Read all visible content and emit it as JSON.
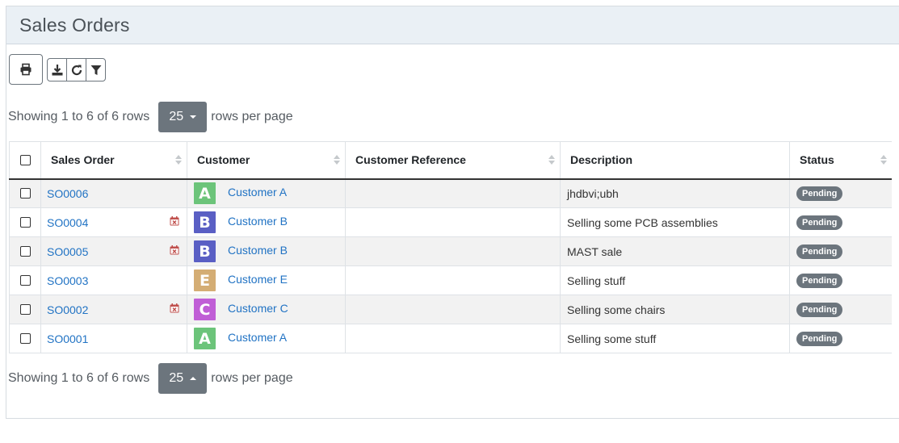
{
  "page": {
    "title": "Sales Orders"
  },
  "toolbar": {
    "print_icon": "print-icon",
    "download_icon": "download-icon",
    "refresh_icon": "refresh-icon",
    "filter_icon": "filter-icon"
  },
  "pagination": {
    "showing_text": "Showing 1 to 6 of 6 rows",
    "page_size": "25",
    "rows_per_page_text": "rows per page"
  },
  "table": {
    "columns": [
      "Sales Order",
      "Customer",
      "Customer Reference",
      "Description",
      "Status"
    ],
    "rows": [
      {
        "so": "SO0006",
        "overdue": false,
        "avatar": "A",
        "avatar_color": "#6cc47a",
        "customer": "Customer A",
        "reference": "",
        "description": "jhdbvi;ubh",
        "status": "Pending"
      },
      {
        "so": "SO0004",
        "overdue": true,
        "avatar": "B",
        "avatar_color": "#5a5fc4",
        "customer": "Customer B",
        "reference": "",
        "description": "Selling some PCB assemblies",
        "status": "Pending"
      },
      {
        "so": "SO0005",
        "overdue": true,
        "avatar": "B",
        "avatar_color": "#5a5fc4",
        "customer": "Customer B",
        "reference": "",
        "description": "MAST sale",
        "status": "Pending"
      },
      {
        "so": "SO0003",
        "overdue": false,
        "avatar": "E",
        "avatar_color": "#d4ad74",
        "customer": "Customer E",
        "reference": "",
        "description": "Selling stuff",
        "status": "Pending"
      },
      {
        "so": "SO0002",
        "overdue": true,
        "avatar": "C",
        "avatar_color": "#c05ed6",
        "customer": "Customer C",
        "reference": "",
        "description": "Selling some chairs",
        "status": "Pending"
      },
      {
        "so": "SO0001",
        "overdue": false,
        "avatar": "A",
        "avatar_color": "#6cc47a",
        "customer": "Customer A",
        "reference": "",
        "description": "Selling some stuff",
        "status": "Pending"
      }
    ]
  },
  "colors": {
    "link": "#2173c4",
    "badge": "#6c757d",
    "overdue_icon": "#c0504d"
  }
}
